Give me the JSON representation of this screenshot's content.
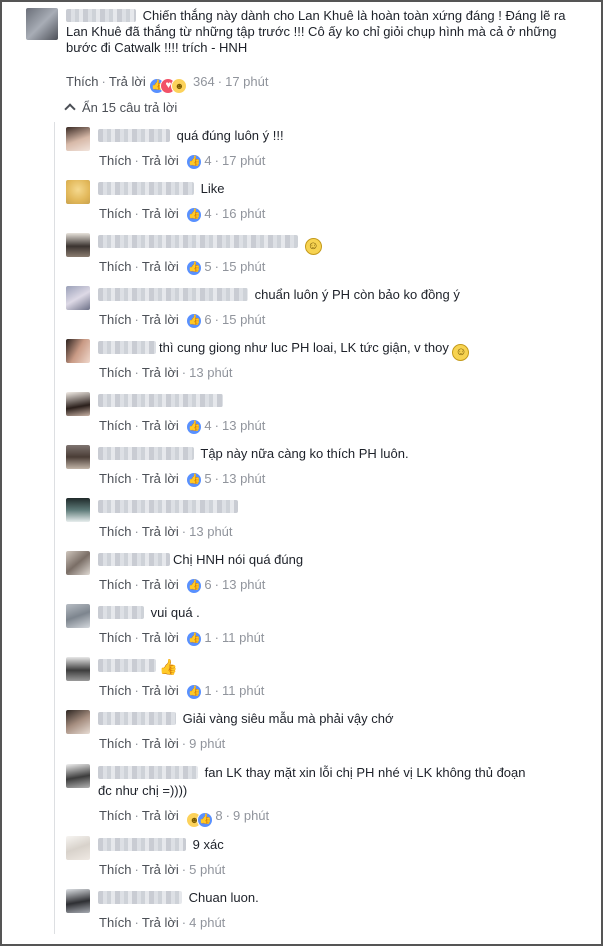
{
  "main": {
    "text": "Chiến thắng này dành cho Lan Khuê là hoàn toàn xứng đáng ! Đáng lẽ ra Lan Khuê đã thắng từ những tập trước !!! Cô ấy ko chỉ giỏi chụp hình mà cả ở những bước đi Catwalk !!!! trích - HNH",
    "like_label": "Thích",
    "reply_label": "Trả lời",
    "reaction_count": "364",
    "time": "17 phút"
  },
  "hide_replies_label": "Ẩn 15 câu trả lời",
  "colors": {
    "link": "#4b4f56",
    "meta": "#90949c",
    "like_blue": "#5890ff",
    "love_red": "#f25268",
    "haha_yellow": "#fcd25b"
  },
  "replies": [
    {
      "text": "quá đúng luôn ý !!!",
      "like_label": "Thích",
      "reply_label": "Trả lời",
      "count": "4",
      "time": "17 phút"
    },
    {
      "text": "Like",
      "like_label": "Thích",
      "reply_label": "Trả lời",
      "count": "4",
      "time": "16 phút"
    },
    {
      "text": "",
      "like_label": "Thích",
      "reply_label": "Trả lời",
      "count": "5",
      "time": "15 phút",
      "emoji": "slightly-smiling-face"
    },
    {
      "text": "chuẩn luôn ý PH còn bảo ko đồng ý",
      "like_label": "Thích",
      "reply_label": "Trả lời",
      "count": "6",
      "time": "15 phút"
    },
    {
      "text": "thì cung giong như luc PH loai, LK tức giận, v thoy",
      "like_label": "Thích",
      "reply_label": "Trả lời",
      "time": "13 phút",
      "emoji": "slightly-smiling-face"
    },
    {
      "text": "",
      "like_label": "Thích",
      "reply_label": "Trả lời",
      "count": "4",
      "time": "13 phút"
    },
    {
      "text": "Tập này nữa càng ko thích PH luôn.",
      "like_label": "Thích",
      "reply_label": "Trả lời",
      "count": "5",
      "time": "13 phút"
    },
    {
      "text": "",
      "like_label": "Thích",
      "reply_label": "Trả lời",
      "time": "13 phút"
    },
    {
      "text": "Chị HNH nói quá đúng",
      "like_label": "Thích",
      "reply_label": "Trả lời",
      "count": "6",
      "time": "13 phút"
    },
    {
      "text": "vui quá .",
      "like_label": "Thích",
      "reply_label": "Trả lời",
      "count": "1",
      "time": "11 phút"
    },
    {
      "text": "",
      "like_label": "Thích",
      "reply_label": "Trả lời",
      "count": "1",
      "time": "11 phút",
      "thumb": "thumbs-up"
    },
    {
      "text": "Giải vàng siêu mẫu mà phải vậy chớ",
      "like_label": "Thích",
      "reply_label": "Trả lời",
      "time": "9 phút"
    },
    {
      "text": "fan LK thay mặt xin lỗi chị PH nhé vị LK không thủ đoạn đc như chị =))))",
      "like_label": "Thích",
      "reply_label": "Trả lời",
      "count": "8",
      "time": "9 phút"
    },
    {
      "text": "9 xác",
      "like_label": "Thích",
      "reply_label": "Trả lời",
      "time": "5 phút"
    },
    {
      "text": "Chuan luon.",
      "like_label": "Thích",
      "reply_label": "Trả lời",
      "time": "4 phút"
    }
  ]
}
